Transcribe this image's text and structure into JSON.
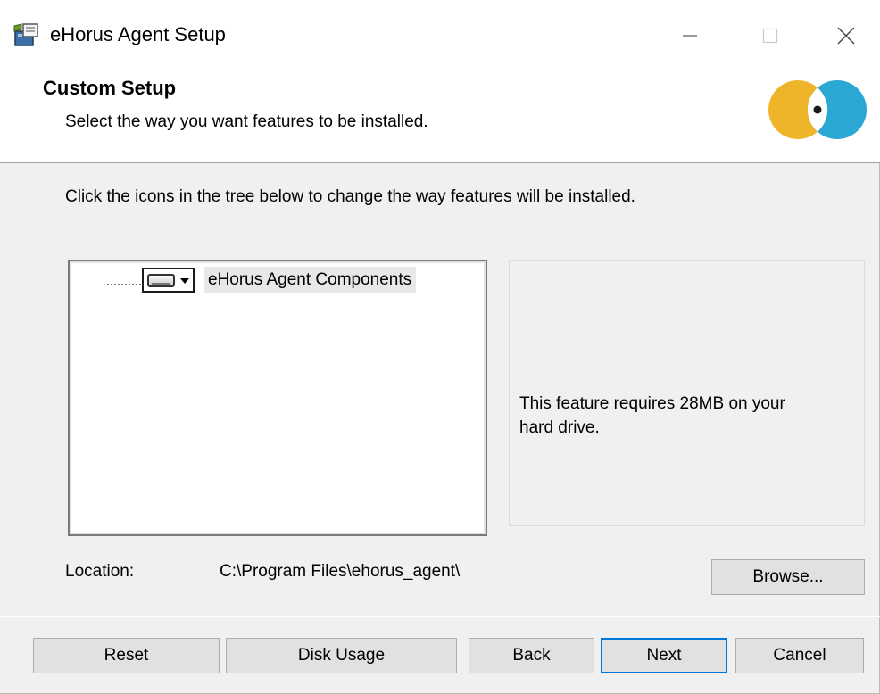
{
  "window": {
    "title": "eHorus Agent Setup"
  },
  "header": {
    "title": "Custom Setup",
    "subtitle": "Select the way you want features to be installed."
  },
  "instruction": "Click the icons in the tree below to change the way features will be installed.",
  "tree": {
    "items": [
      {
        "label": "eHorus Agent Components",
        "icon": "hard-drive-icon",
        "state": "selected"
      }
    ]
  },
  "description": "This feature requires 28MB on your hard drive.",
  "location": {
    "label": "Location:",
    "value": "C:\\Program Files\\ehorus_agent\\"
  },
  "buttons": {
    "browse": "Browse...",
    "reset": "Reset",
    "disk_usage": "Disk Usage",
    "back": "Back",
    "next": "Next",
    "cancel": "Cancel"
  },
  "colors": {
    "logo_yellow": "#efb52a",
    "logo_blue": "#2aa8d3",
    "default_button_border": "#0078d7"
  }
}
